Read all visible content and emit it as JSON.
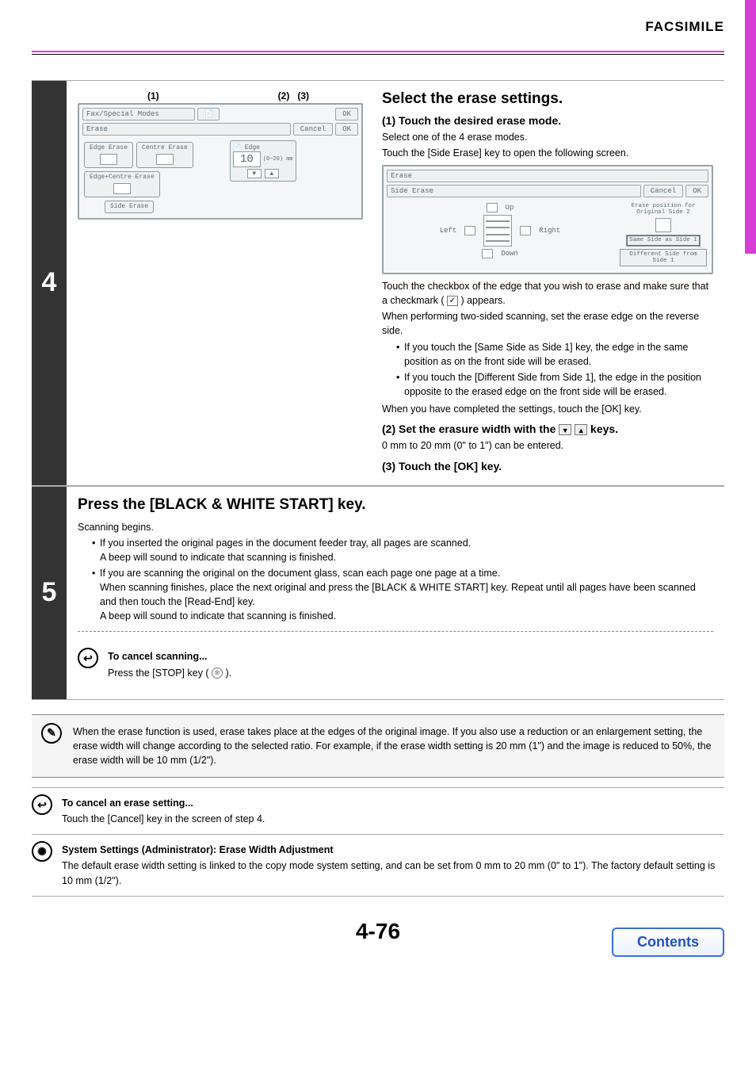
{
  "header": {
    "title": "FACSIMILE"
  },
  "step4": {
    "num": "4",
    "callouts": [
      "(1)",
      "(2)",
      "(3)"
    ],
    "title": "Select the erase settings.",
    "lcd1": {
      "breadcrumb": "Fax/Special Modes",
      "title": "Erase",
      "ok1": "OK",
      "cancel": "Cancel",
      "ok2": "OK",
      "modes": [
        "Edge\nErase",
        "Centre\nErase",
        "Edge+Centre\nErase",
        "Side Erase"
      ],
      "edge": {
        "label": "Edge",
        "value": "10",
        "range": "(0~20)\nmm"
      }
    },
    "lcd2": {
      "breadcrumb": "Erase",
      "title": "Side Erase",
      "cancel": "Cancel",
      "ok": "OK",
      "up": "Up",
      "left": "Left",
      "right": "Right",
      "down": "Down",
      "eraseposition": "Erase position\nfor Original Side 2",
      "sameside": "Same Side as\nSide 1",
      "diffside": "Different Side\nfrom Side 1"
    },
    "sub1": {
      "heading": "(1) Touch the desired erase mode.",
      "p1": "Select one of the 4 erase modes.",
      "p2": "Touch the [Side Erase] key to open the following screen.",
      "p3a": "Touch the checkbox of the edge that you wish to erase and make sure that a checkmark (",
      "p3b": ") appears.",
      "p4": "When performing two-sided scanning, set the erase edge on the reverse side.",
      "b1": "If you touch the [Same Side as Side 1] key, the edge in the same position as on the front side will be erased.",
      "b2": "If you touch the [Different Side from Side 1], the edge in the position opposite to the erased edge on the front side will be erased.",
      "p5": "When you have completed the settings, touch the [OK] key."
    },
    "sub2": {
      "heading_a": "(2) Set the erasure width with the ",
      "heading_b": " keys.",
      "p": "0 mm to 20 mm (0\" to 1\") can be entered."
    },
    "sub3": {
      "heading": "(3) Touch the [OK] key."
    }
  },
  "step5": {
    "num": "5",
    "title": "Press the [BLACK & WHITE START] key.",
    "p1": "Scanning begins.",
    "b1a": "If you inserted the original pages in the document feeder tray, all pages are scanned.",
    "b1b": "A beep will sound to indicate that scanning is finished.",
    "b2a": "If you are scanning the original on the document glass, scan each page one page at a time.",
    "b2b": "When scanning finishes, place the next original and press the [BLACK & WHITE START] key. Repeat until all pages have been scanned and then touch the [Read-End] key.",
    "b2c": "A beep will sound to indicate that scanning is finished.",
    "cancel": {
      "heading": "To cancel scanning...",
      "text_a": "Press the [STOP] key (",
      "text_b": ")."
    }
  },
  "notes": {
    "ratio": "When the erase function is used, erase takes place at the edges of the original image. If you also use a reduction or an enlargement setting, the erase width will change according to the selected ratio. For example, if the erase width setting is 20 mm (1\") and the image is reduced to 50%, the erase width will be 10 mm (1/2\").",
    "cancel": {
      "heading": "To cancel an erase setting...",
      "text": "Touch the [Cancel] key in the screen of step 4."
    },
    "system": {
      "heading": "System Settings (Administrator): Erase Width Adjustment",
      "text": "The default erase width setting is linked to the copy mode system setting, and can be set from 0 mm to 20 mm (0\" to 1\"). The factory default setting is 10 mm (1/2\")."
    }
  },
  "footer": {
    "page": "4-76",
    "contents": "Contents"
  }
}
